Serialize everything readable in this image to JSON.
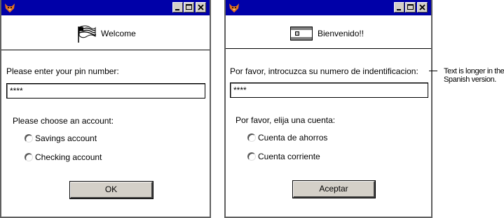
{
  "english": {
    "welcome": "Welcome",
    "pin_label": "Please enter your pin number:",
    "pin_value": "****",
    "account_label": "Please choose an account:",
    "options": [
      "Savings account",
      "Checking account"
    ],
    "ok_button": "OK"
  },
  "spanish": {
    "welcome": "Bienvenido!!",
    "pin_label": "Por favor, introcuzca su numero de indentificacion:",
    "pin_value": "****",
    "account_label": "Por favor, elija una cuenta:",
    "options": [
      "Cuenta de ahorros",
      "Cuenta corriente"
    ],
    "ok_button": "Aceptar"
  },
  "annotation": {
    "line1": "Text is longer in the",
    "line2": "Spanish version."
  },
  "icons": {
    "app": "fox-app-icon",
    "minimize": "minimize-icon",
    "maximize": "maximize-icon",
    "close": "close-icon",
    "flag_en": "us-flag-icon",
    "flag_es": "spanish-flag-icon"
  },
  "colors": {
    "titlebar": "#0000a8",
    "button_face": "#d4d0c8"
  }
}
